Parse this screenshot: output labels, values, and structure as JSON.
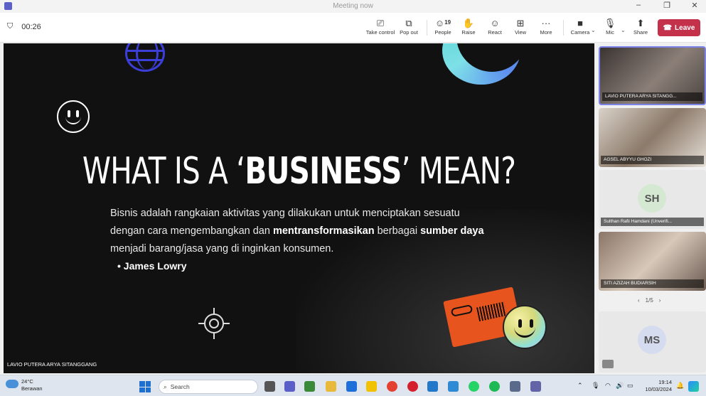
{
  "window": {
    "title": "Meeting now"
  },
  "toolbar": {
    "timer": "00:26",
    "take_control": "Take control",
    "pop_out": "Pop out",
    "people": "People",
    "people_count": "19",
    "raise": "Raise",
    "react": "React",
    "view": "View",
    "more": "More",
    "camera": "Camera",
    "mic": "Mic",
    "share": "Share",
    "leave": "Leave",
    "leave_color": "#c4314b"
  },
  "slide": {
    "headline_pre": "WHAT IS A ‘",
    "headline_bold": "BUSINESS",
    "headline_post": "’ MEAN?",
    "p1": "Bisnis adalah rangkaian aktivitas yang dilakukan untuk menciptakan sesuatu dengan cara mengembangkan dan ",
    "p1_bold": "mentransformasikan",
    "p2": " berbagai ",
    "p2_bold": "sumber daya",
    "p3": " menjadi barang/jasa yang di inginkan konsumen.",
    "bullet": "• James Lowry",
    "presenter": "LAVIO PUTERA ARYA SITANGGANG"
  },
  "participants": [
    {
      "name": "LAVIO PUTERA ARYA SITANGG..."
    },
    {
      "name": "AGSEL ABYYU GHOZI"
    },
    {
      "name": "Sulthan Rafii Hamdani (Unverifi...",
      "initials": "SH"
    },
    {
      "name": "SITI AZIZAH BUDIARSIH"
    },
    {
      "initials": "MS"
    }
  ],
  "pager": {
    "text": "1/5"
  },
  "taskbar": {
    "temp": "24°C",
    "weather": "Berawan",
    "search_placeholder": "Search",
    "time": "19:14",
    "date": "10/03/2024"
  }
}
